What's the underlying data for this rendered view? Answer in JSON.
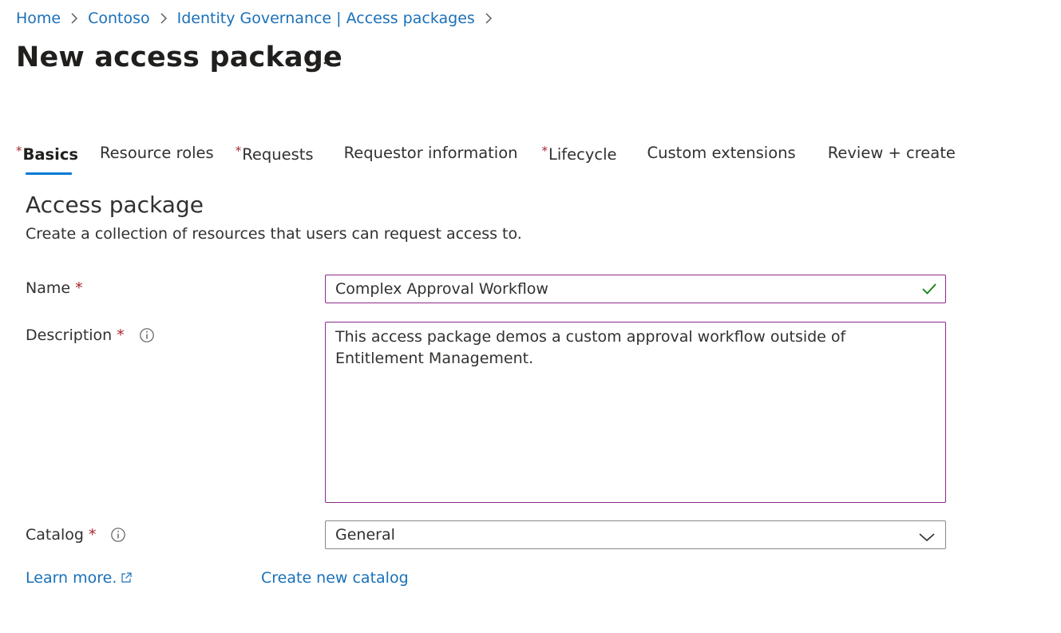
{
  "breadcrumb": {
    "items": [
      "Home",
      "Contoso",
      "Identity Governance | Access packages"
    ]
  },
  "page": {
    "title": "New access package",
    "more_label": "..."
  },
  "tabs": [
    {
      "label": "Basics",
      "required": true,
      "active": true
    },
    {
      "label": "Resource roles",
      "required": false,
      "active": false
    },
    {
      "label": "Requests",
      "required": true,
      "active": false
    },
    {
      "label": "Requestor information",
      "required": false,
      "active": false
    },
    {
      "label": "Lifecycle",
      "required": true,
      "active": false
    },
    {
      "label": "Custom extensions",
      "required": false,
      "active": false
    },
    {
      "label": "Review + create",
      "required": false,
      "active": false
    }
  ],
  "section": {
    "title": "Access package",
    "description": "Create a collection of resources that users can request access to."
  },
  "form": {
    "required_marker": "*",
    "name": {
      "label": "Name",
      "value": "Complex Approval Workflow"
    },
    "description": {
      "label": "Description",
      "value": "This access package demos a custom approval workflow outside of Entitlement Management."
    },
    "catalog": {
      "label": "Catalog",
      "value": "General"
    }
  },
  "links": {
    "learn_more": "Learn more.",
    "create_catalog": "Create new catalog"
  },
  "colors": {
    "link": "#1a70b8",
    "required": "#a4262c",
    "active_tab": "#0078d4",
    "input_focus_border": "#8a2a8a",
    "valid_check": "#107c10"
  }
}
